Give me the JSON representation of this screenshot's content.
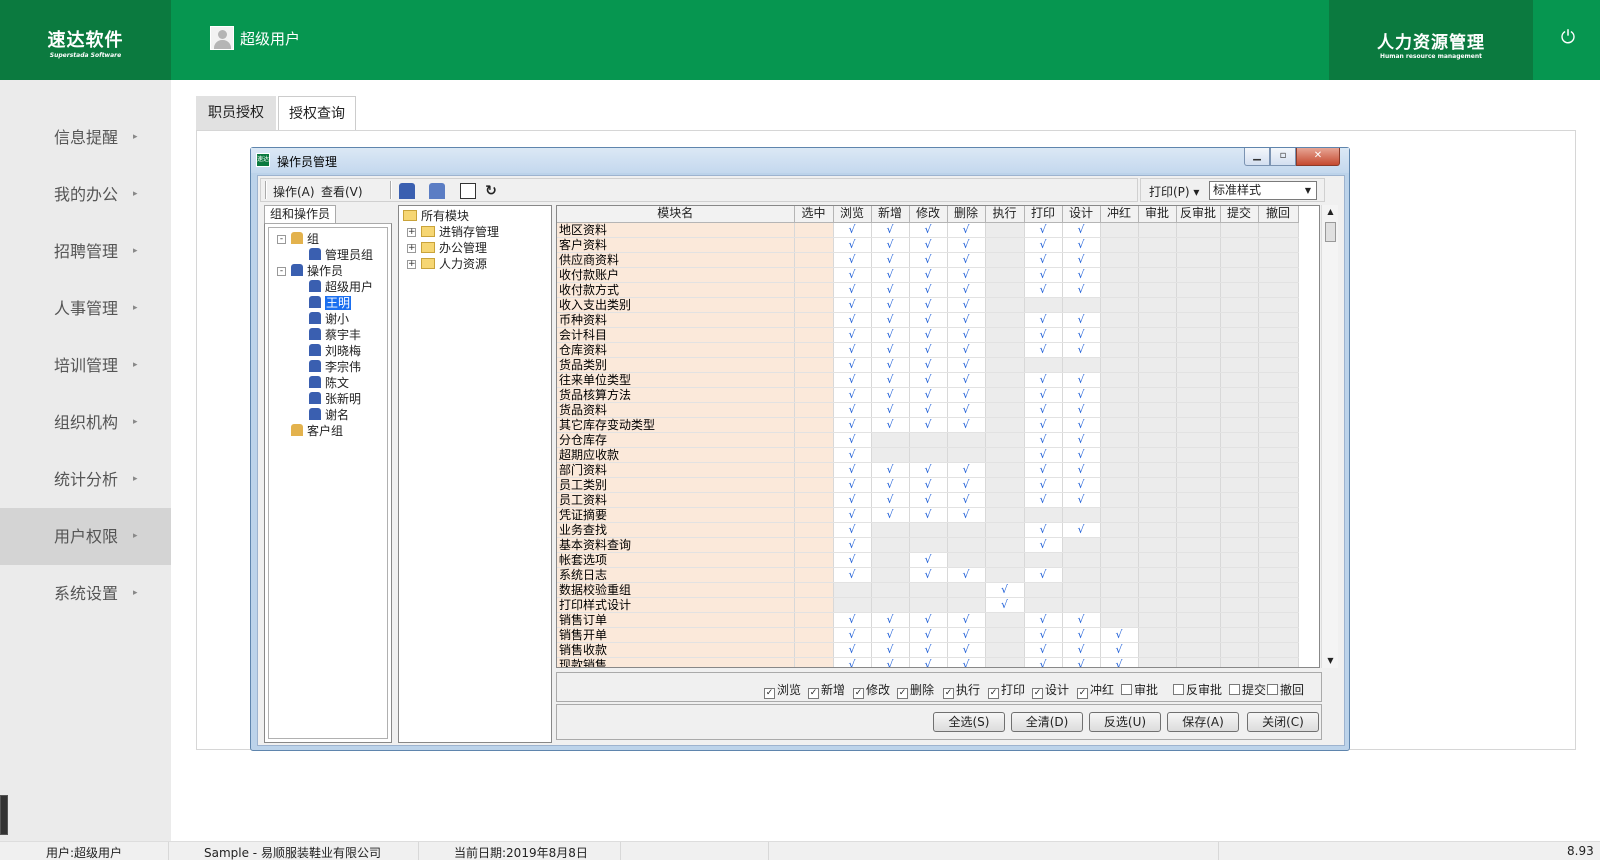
{
  "header": {
    "logo_cn": "速达软件",
    "logo_en": "Superstada Software",
    "user_name": "超级用户",
    "system_cn": "人力资源管理",
    "system_en": "Human resource management",
    "power_icon": "power-icon",
    "brand_color": "#069650",
    "brand_dark": "#0b7a3f"
  },
  "sidebar": {
    "items": [
      {
        "label": "信息提醒"
      },
      {
        "label": "我的办公"
      },
      {
        "label": "招聘管理"
      },
      {
        "label": "人事管理"
      },
      {
        "label": "培训管理"
      },
      {
        "label": "组织机构"
      },
      {
        "label": "统计分析"
      },
      {
        "label": "用户权限",
        "active": true
      },
      {
        "label": "系统设置"
      }
    ]
  },
  "tabs": [
    "职员授权",
    "授权查询"
  ],
  "window": {
    "title": "操作员管理",
    "menu_operate": "操作(A)",
    "menu_view": "查看(V)",
    "print_label": "打印(P) ▾",
    "print_style": "标准样式",
    "group_tab": "组和操作员"
  },
  "group_tree": [
    {
      "label": "组",
      "level": 0,
      "pm": "-"
    },
    {
      "label": "管理员组",
      "level": 1
    },
    {
      "label": "操作员",
      "level": 0,
      "pm": "-"
    },
    {
      "label": "超级用户",
      "level": 1
    },
    {
      "label": "王明",
      "level": 1,
      "selected": true
    },
    {
      "label": "谢小",
      "level": 1
    },
    {
      "label": "蔡宇丰",
      "level": 1
    },
    {
      "label": "刘晓梅",
      "level": 1
    },
    {
      "label": "李宗伟",
      "level": 1
    },
    {
      "label": "陈文",
      "level": 1
    },
    {
      "label": "张新明",
      "level": 1
    },
    {
      "label": "谢名",
      "level": 1
    },
    {
      "label": "客户组",
      "level": 0
    }
  ],
  "module_tree": {
    "root": "所有模块",
    "children": [
      "进销存管理",
      "办公管理",
      "人力资源"
    ]
  },
  "grid": {
    "columns": [
      "模块名",
      "选中",
      "浏览",
      "新增",
      "修改",
      "删除",
      "执行",
      "打印",
      "设计",
      "冲红",
      "审批",
      "反审批",
      "提交",
      "撤回"
    ],
    "check_mark": "√",
    "rows": [
      {
        "name": "地区资料",
        "p": [
          1,
          1,
          1,
          1,
          0,
          1,
          1,
          0,
          0,
          0,
          0,
          0
        ],
        "na": [
          0,
          0,
          0,
          0,
          1,
          0,
          0,
          1,
          1,
          1,
          1,
          1
        ]
      },
      {
        "name": "客户资料",
        "p": [
          1,
          1,
          1,
          1,
          0,
          1,
          1,
          0,
          0,
          0,
          0,
          0
        ],
        "na": [
          0,
          0,
          0,
          0,
          1,
          0,
          0,
          1,
          1,
          1,
          1,
          1
        ]
      },
      {
        "name": "供应商资料",
        "p": [
          1,
          1,
          1,
          1,
          0,
          1,
          1,
          0,
          0,
          0,
          0,
          0
        ],
        "na": [
          0,
          0,
          0,
          0,
          1,
          0,
          0,
          1,
          1,
          1,
          1,
          1
        ]
      },
      {
        "name": "收付款账户",
        "p": [
          1,
          1,
          1,
          1,
          0,
          1,
          1,
          0,
          0,
          0,
          0,
          0
        ],
        "na": [
          0,
          0,
          0,
          0,
          1,
          0,
          0,
          1,
          1,
          1,
          1,
          1
        ]
      },
      {
        "name": "收付款方式",
        "p": [
          1,
          1,
          1,
          1,
          0,
          1,
          1,
          0,
          0,
          0,
          0,
          0
        ],
        "na": [
          0,
          0,
          0,
          0,
          1,
          0,
          0,
          1,
          1,
          1,
          1,
          1
        ]
      },
      {
        "name": "收入支出类别",
        "p": [
          1,
          1,
          1,
          1,
          0,
          0,
          0,
          0,
          0,
          0,
          0,
          0
        ],
        "na": [
          0,
          0,
          0,
          0,
          1,
          1,
          1,
          1,
          1,
          1,
          1,
          1
        ]
      },
      {
        "name": "币种资料",
        "p": [
          1,
          1,
          1,
          1,
          0,
          1,
          1,
          0,
          0,
          0,
          0,
          0
        ],
        "na": [
          0,
          0,
          0,
          0,
          1,
          0,
          0,
          1,
          1,
          1,
          1,
          1
        ]
      },
      {
        "name": "会计科目",
        "p": [
          1,
          1,
          1,
          1,
          0,
          1,
          1,
          0,
          0,
          0,
          0,
          0
        ],
        "na": [
          0,
          0,
          0,
          0,
          1,
          0,
          0,
          1,
          1,
          1,
          1,
          1
        ]
      },
      {
        "name": "仓库资料",
        "p": [
          1,
          1,
          1,
          1,
          0,
          1,
          1,
          0,
          0,
          0,
          0,
          0
        ],
        "na": [
          0,
          0,
          0,
          0,
          1,
          0,
          0,
          1,
          1,
          1,
          1,
          1
        ]
      },
      {
        "name": "货品类别",
        "p": [
          1,
          1,
          1,
          1,
          0,
          0,
          0,
          0,
          0,
          0,
          0,
          0
        ],
        "na": [
          0,
          0,
          0,
          0,
          1,
          1,
          1,
          1,
          1,
          1,
          1,
          1
        ]
      },
      {
        "name": "往来单位类型",
        "p": [
          1,
          1,
          1,
          1,
          0,
          1,
          1,
          0,
          0,
          0,
          0,
          0
        ],
        "na": [
          0,
          0,
          0,
          0,
          1,
          0,
          0,
          1,
          1,
          1,
          1,
          1
        ]
      },
      {
        "name": "货品核算方法",
        "p": [
          1,
          1,
          1,
          1,
          0,
          1,
          1,
          0,
          0,
          0,
          0,
          0
        ],
        "na": [
          0,
          0,
          0,
          0,
          1,
          0,
          0,
          1,
          1,
          1,
          1,
          1
        ]
      },
      {
        "name": "货品资料",
        "p": [
          1,
          1,
          1,
          1,
          0,
          1,
          1,
          0,
          0,
          0,
          0,
          0
        ],
        "na": [
          0,
          0,
          0,
          0,
          1,
          0,
          0,
          1,
          1,
          1,
          1,
          1
        ]
      },
      {
        "name": "其它库存变动类型",
        "p": [
          1,
          1,
          1,
          1,
          0,
          1,
          1,
          0,
          0,
          0,
          0,
          0
        ],
        "na": [
          0,
          0,
          0,
          0,
          1,
          0,
          0,
          1,
          1,
          1,
          1,
          1
        ]
      },
      {
        "name": "分仓库存",
        "p": [
          1,
          0,
          0,
          0,
          0,
          1,
          1,
          0,
          0,
          0,
          0,
          0
        ],
        "na": [
          0,
          1,
          1,
          1,
          1,
          0,
          0,
          1,
          1,
          1,
          1,
          1
        ]
      },
      {
        "name": "超期应收款",
        "p": [
          1,
          0,
          0,
          0,
          0,
          1,
          1,
          0,
          0,
          0,
          0,
          0
        ],
        "na": [
          0,
          1,
          1,
          1,
          1,
          0,
          0,
          1,
          1,
          1,
          1,
          1
        ]
      },
      {
        "name": "部门资料",
        "p": [
          1,
          1,
          1,
          1,
          0,
          1,
          1,
          0,
          0,
          0,
          0,
          0
        ],
        "na": [
          0,
          0,
          0,
          0,
          1,
          0,
          0,
          1,
          1,
          1,
          1,
          1
        ]
      },
      {
        "name": "员工类别",
        "p": [
          1,
          1,
          1,
          1,
          0,
          1,
          1,
          0,
          0,
          0,
          0,
          0
        ],
        "na": [
          0,
          0,
          0,
          0,
          1,
          0,
          0,
          1,
          1,
          1,
          1,
          1
        ]
      },
      {
        "name": "员工资料",
        "p": [
          1,
          1,
          1,
          1,
          0,
          1,
          1,
          0,
          0,
          0,
          0,
          0
        ],
        "na": [
          0,
          0,
          0,
          0,
          1,
          0,
          0,
          1,
          1,
          1,
          1,
          1
        ]
      },
      {
        "name": "凭证摘要",
        "p": [
          1,
          1,
          1,
          1,
          0,
          0,
          0,
          0,
          0,
          0,
          0,
          0
        ],
        "na": [
          0,
          0,
          0,
          0,
          1,
          1,
          1,
          1,
          1,
          1,
          1,
          1
        ]
      },
      {
        "name": "业务查找",
        "p": [
          1,
          0,
          0,
          0,
          0,
          1,
          1,
          0,
          0,
          0,
          0,
          0
        ],
        "na": [
          0,
          1,
          1,
          1,
          1,
          0,
          0,
          1,
          1,
          1,
          1,
          1
        ]
      },
      {
        "name": "基本资料查询",
        "p": [
          1,
          0,
          0,
          0,
          0,
          1,
          0,
          0,
          0,
          0,
          0,
          0
        ],
        "na": [
          0,
          1,
          1,
          1,
          1,
          0,
          1,
          1,
          1,
          1,
          1,
          1
        ]
      },
      {
        "name": "帐套选项",
        "p": [
          1,
          0,
          1,
          0,
          0,
          0,
          0,
          0,
          0,
          0,
          0,
          0
        ],
        "na": [
          0,
          1,
          0,
          1,
          1,
          1,
          1,
          1,
          1,
          1,
          1,
          1
        ]
      },
      {
        "name": "系统日志",
        "p": [
          1,
          0,
          1,
          1,
          0,
          1,
          0,
          0,
          0,
          0,
          0,
          0
        ],
        "na": [
          0,
          1,
          0,
          0,
          1,
          0,
          1,
          1,
          1,
          1,
          1,
          1
        ]
      },
      {
        "name": "数据校验重组",
        "p": [
          0,
          0,
          0,
          0,
          1,
          0,
          0,
          0,
          0,
          0,
          0,
          0
        ],
        "na": [
          1,
          1,
          1,
          1,
          0,
          1,
          1,
          1,
          1,
          1,
          1,
          1
        ]
      },
      {
        "name": "打印样式设计",
        "p": [
          0,
          0,
          0,
          0,
          1,
          0,
          0,
          0,
          0,
          0,
          0,
          0
        ],
        "na": [
          1,
          1,
          1,
          1,
          0,
          1,
          1,
          1,
          1,
          1,
          1,
          1
        ]
      },
      {
        "name": "销售订单",
        "p": [
          1,
          1,
          1,
          1,
          0,
          1,
          1,
          0,
          0,
          0,
          0,
          0
        ],
        "na": [
          0,
          0,
          0,
          0,
          1,
          0,
          0,
          1,
          1,
          1,
          1,
          1
        ]
      },
      {
        "name": "销售开单",
        "p": [
          1,
          1,
          1,
          1,
          0,
          1,
          1,
          1,
          0,
          0,
          0,
          0
        ],
        "na": [
          0,
          0,
          0,
          0,
          1,
          0,
          0,
          0,
          1,
          1,
          1,
          1
        ]
      },
      {
        "name": "销售收款",
        "p": [
          1,
          1,
          1,
          1,
          0,
          1,
          1,
          1,
          0,
          0,
          0,
          0
        ],
        "na": [
          0,
          0,
          0,
          0,
          1,
          0,
          0,
          0,
          1,
          1,
          1,
          1
        ]
      },
      {
        "name": "现款销售",
        "p": [
          1,
          1,
          1,
          1,
          0,
          1,
          1,
          1,
          0,
          0,
          0,
          0
        ],
        "na": [
          0,
          0,
          0,
          0,
          1,
          0,
          0,
          0,
          1,
          1,
          1,
          1
        ]
      }
    ]
  },
  "checks": [
    {
      "label": "浏览",
      "checked": true
    },
    {
      "label": "新增",
      "checked": true
    },
    {
      "label": "修改",
      "checked": true
    },
    {
      "label": "删除",
      "checked": true
    },
    {
      "label": "执行",
      "checked": true
    },
    {
      "label": "打印",
      "checked": true
    },
    {
      "label": "设计",
      "checked": true
    },
    {
      "label": "冲红",
      "checked": true
    },
    {
      "label": "审批",
      "checked": false
    },
    {
      "label": "反审批",
      "checked": false
    },
    {
      "label": "提交",
      "checked": false
    },
    {
      "label": "撤回",
      "checked": false
    }
  ],
  "buttons": [
    "全选(S)",
    "全清(D)",
    "反选(U)",
    "保存(A)",
    "关闭(C)"
  ],
  "status": {
    "user": "用户:超级用户",
    "company": "Sample - 易顺服装鞋业有限公司",
    "date": "当前日期:2019年8月8日",
    "version": "8.93"
  }
}
